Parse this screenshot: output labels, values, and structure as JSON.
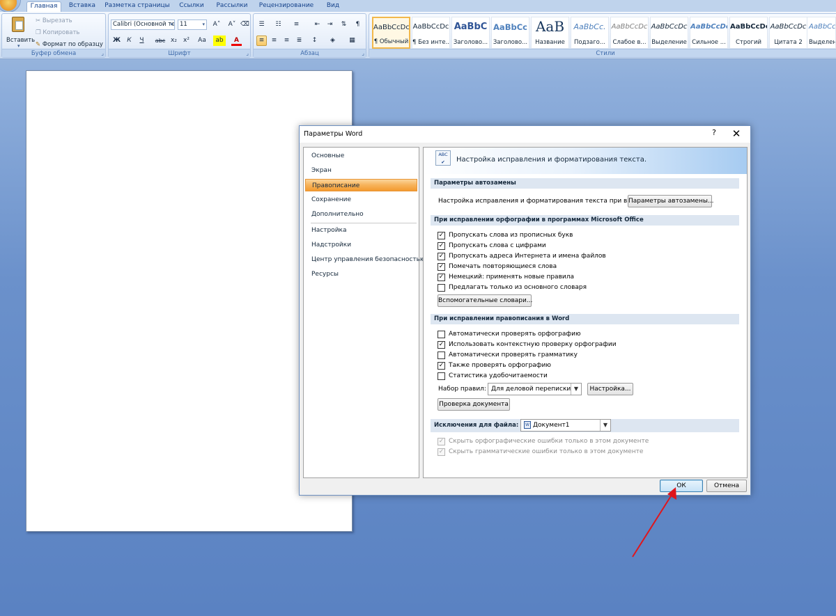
{
  "ribbon": {
    "tabs": [
      {
        "label": "Главная",
        "active": true
      },
      {
        "label": "Вставка"
      },
      {
        "label": "Разметка страницы"
      },
      {
        "label": "Ссылки"
      },
      {
        "label": "Рассылки"
      },
      {
        "label": "Рецензирование"
      },
      {
        "label": "Вид"
      }
    ],
    "clipboard": {
      "label": "Буфер обмена",
      "paste": "Вставить",
      "cut": "Вырезать",
      "copy": "Копировать",
      "format_painter": "Формат по образцу"
    },
    "font": {
      "label": "Шрифт",
      "font_name": "Calibri (Основной те",
      "font_size": "11",
      "grow": "A˄",
      "shrink": "A˅",
      "bold": "Ж",
      "italic": "К",
      "underline": "Ч",
      "strike": "abc",
      "subscript": "x₂",
      "superscript": "x²",
      "case": "Aa",
      "highlight": "ab",
      "color": "A"
    },
    "paragraph": {
      "label": "Абзац"
    },
    "styles": {
      "label": "Стили",
      "items": [
        {
          "sample": "AaBbCcDc",
          "name": "¶ Обычный",
          "selected": true
        },
        {
          "sample": "AaBbCcDc",
          "name": "¶ Без инте..."
        },
        {
          "sample": "AaBbC",
          "name": "Заголово..."
        },
        {
          "sample": "AaBbCc",
          "name": "Заголово..."
        },
        {
          "sample": "AaB",
          "name": "Название"
        },
        {
          "sample": "AaBbCc.",
          "name": "Подзаго..."
        },
        {
          "sample": "AaBbCcDc",
          "name": "Слабое в..."
        },
        {
          "sample": "AaBbCcDc",
          "name": "Выделение"
        },
        {
          "sample": "AaBbCcDc",
          "name": "Сильное ..."
        },
        {
          "sample": "AaBbCcDc",
          "name": "Строгий"
        },
        {
          "sample": "AaBbCcDc",
          "name": "Цитата 2"
        },
        {
          "sample": "AaBbCc",
          "name": "Выделен"
        }
      ]
    }
  },
  "dialog": {
    "title": "Параметры Word",
    "help": "?",
    "close": "✕",
    "nav": [
      "Основные",
      "Экран",
      "Правописание",
      "Сохранение",
      "Дополнительно",
      "Настройка",
      "Надстройки",
      "Центр управления безопасностью",
      "Ресурсы"
    ],
    "header_icon": "ABC",
    "header_text": "Настройка исправления и форматирования текста.",
    "autocorrect": {
      "section": "Параметры автозамены",
      "text": "Настройка исправления и форматирования текста при вводе:",
      "button": "Параметры автозамены..."
    },
    "office_spelling": {
      "section": "При исправлении орфографии в программах Microsoft Office",
      "options": [
        {
          "label": "Пропускать слова из прописных букв",
          "checked": true
        },
        {
          "label": "Пропускать слова с цифрами",
          "checked": true
        },
        {
          "label": "Пропускать адреса Интернета и имена файлов",
          "checked": true
        },
        {
          "label": "Помечать повторяющиеся слова",
          "checked": true
        },
        {
          "label": "Немецкий: применять новые правила",
          "checked": true
        },
        {
          "label": "Предлагать только из основного словаря",
          "checked": false
        }
      ],
      "dict_button": "Вспомогательные словари..."
    },
    "word_spelling": {
      "section": "При исправлении правописания в Word",
      "options": [
        {
          "label": "Автоматически проверять орфографию",
          "checked": false
        },
        {
          "label": "Использовать контекстную проверку орфографии",
          "checked": true
        },
        {
          "label": "Автоматически проверять грамматику",
          "checked": false
        },
        {
          "label": "Также проверять орфографию",
          "checked": true
        },
        {
          "label": "Статистика удобочитаемости",
          "checked": false
        }
      ],
      "ruleset_label": "Набор правил:",
      "ruleset_value": "Для деловой переписки",
      "settings_button": "Настройка...",
      "check_button": "Проверка документа"
    },
    "exceptions": {
      "section": "Исключения для файла:",
      "file": "Документ1",
      "options": [
        {
          "label": "Скрыть орфографические ошибки только в этом документе",
          "checked": true
        },
        {
          "label": "Скрыть грамматические ошибки только в этом документе",
          "checked": true
        }
      ]
    },
    "ok": "ОК",
    "cancel": "Отмена"
  },
  "colors": {
    "annotation_arrow": "#e0151b",
    "nav_active": "#f7b25a"
  }
}
